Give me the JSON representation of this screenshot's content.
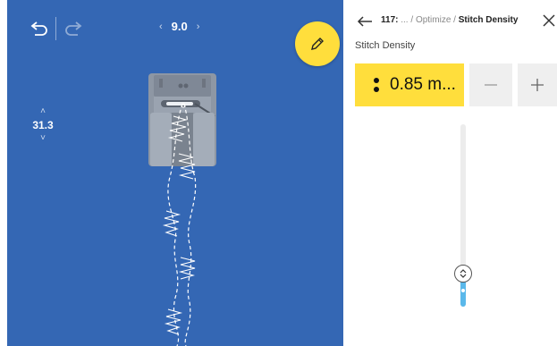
{
  "canvas": {
    "undo_icon": "undo-arrow",
    "redo_icon": "redo-arrow",
    "zoom": {
      "prev": "‹",
      "value": "9.0",
      "next": "›"
    },
    "edit_icon": "pencil",
    "side_value": {
      "up": "˄",
      "value": "31.3",
      "down": "˅"
    },
    "background_color": "#3467b4",
    "edit_button_color": "#ffde3c"
  },
  "panel": {
    "back_icon": "arrow-left",
    "breadcrumb": {
      "id": "117:",
      "ellipsis": "...",
      "sep1": " / ",
      "parent": "Optimize",
      "sep2": " / ",
      "current": "Stitch Density"
    },
    "close_icon": "close-x",
    "title": "Stitch Density",
    "value_display": "0.85 m...",
    "minus_label": "—",
    "plus_label": "+",
    "slider": {
      "level": 0.15,
      "accent_color": "#5ab8ea"
    },
    "highlight_color": "#ffde3c"
  }
}
